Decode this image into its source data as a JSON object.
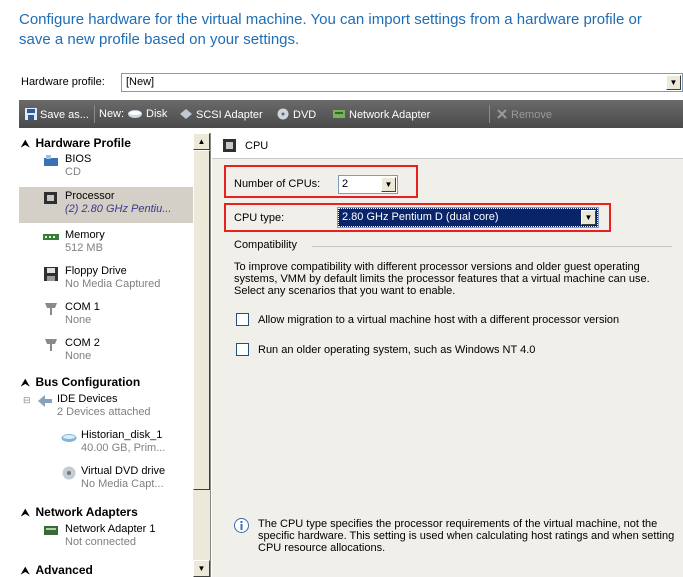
{
  "intro": "Configure hardware for the virtual machine. You can import settings from a hardware profile or save a new profile based on your settings.",
  "hardware_profile": {
    "label": "Hardware profile:",
    "value": "[New]"
  },
  "toolbar": {
    "save_as": "Save as...",
    "new_label": "New:",
    "disk": "Disk",
    "scsi": "SCSI Adapter",
    "dvd": "DVD",
    "network": "Network Adapter",
    "remove": "Remove"
  },
  "tree": {
    "sections": [
      "Hardware Profile",
      "Bus Configuration",
      "Network Adapters",
      "Advanced"
    ],
    "items": [
      {
        "title": "BIOS",
        "sub": "CD"
      },
      {
        "title": "Processor",
        "sub": "(2) 2.80 GHz Pentiu..."
      },
      {
        "title": "Memory",
        "sub": "512 MB"
      },
      {
        "title": "Floppy Drive",
        "sub": "No Media Captured"
      },
      {
        "title": "COM 1",
        "sub": "None"
      },
      {
        "title": "COM 2",
        "sub": "None"
      },
      {
        "title": "IDE Devices",
        "sub": "2 Devices attached"
      },
      {
        "title": "Historian_disk_1",
        "sub": "40.00 GB, Prim..."
      },
      {
        "title": "Virtual DVD drive",
        "sub": "No Media Capt..."
      },
      {
        "title": "Network Adapter 1",
        "sub": "Not connected"
      }
    ]
  },
  "cpu": {
    "header": "CPU",
    "num_label": "Number of CPUs:",
    "num_value": "2",
    "type_label": "CPU type:",
    "type_value": "2.80 GHz Pentium D (dual core)",
    "compat_title": "Compatibility",
    "compat_text": "To improve compatibility with different processor versions and older guest operating systems, VMM by default limits the processor features that a virtual machine can use. Select any scenarios that you want to enable.",
    "opt_migration": "Allow migration to a virtual machine host with a different processor version",
    "opt_older_os": "Run an older operating system, such as Windows NT 4.0",
    "info": "The CPU type specifies the processor requirements of the virtual machine, not the specific hardware. This setting is used when calculating host ratings and when setting CPU resource allocations."
  },
  "colors": {
    "intro": "#1f6db4",
    "highlight": "#e8201f",
    "selection": "#0a246a"
  }
}
